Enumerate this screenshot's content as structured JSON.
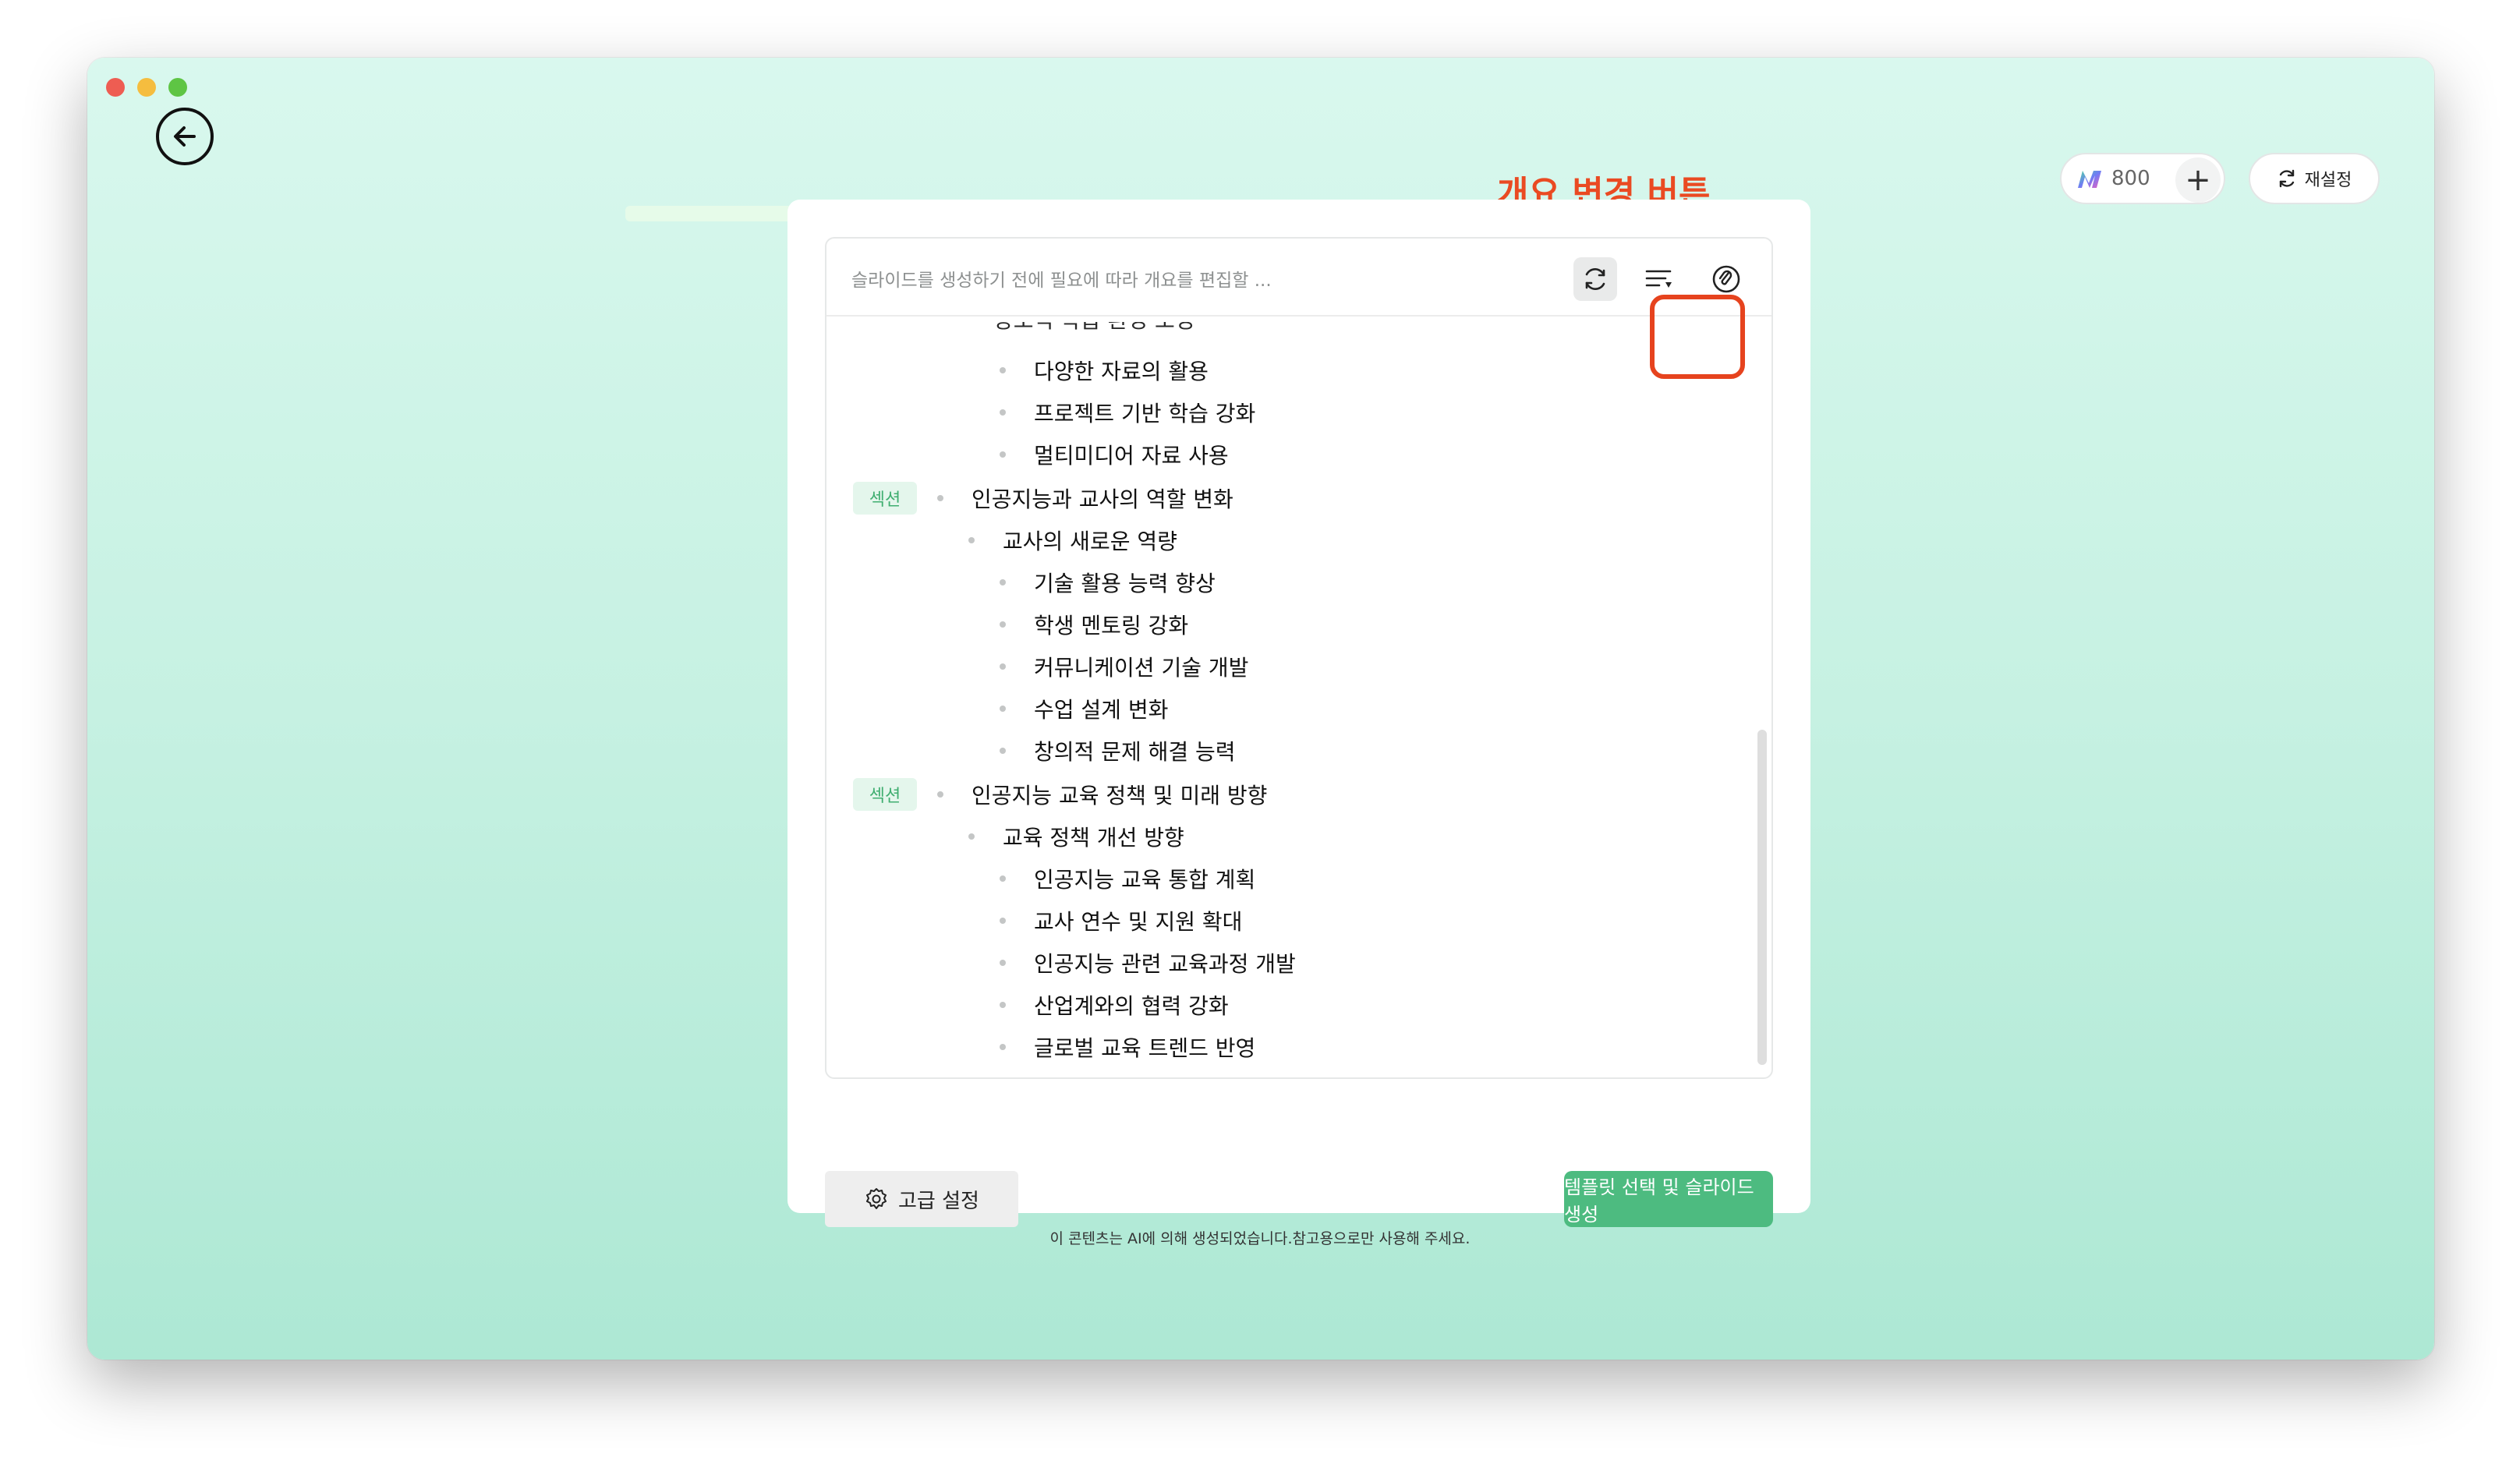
{
  "annotation": "개요 변경 버튼",
  "header": {
    "credits": "800",
    "reset_label": "재설정"
  },
  "editor": {
    "placeholder": "슬라이드를 생성하기 전에 필요에 따라 개요를 편집할 ...",
    "section_badge": "섹션",
    "rows": [
      {
        "level": 3,
        "text": "다양한 자료의 활용"
      },
      {
        "level": 3,
        "text": "프로젝트 기반 학습 강화"
      },
      {
        "level": 3,
        "text": "멀티미디어 자료 사용"
      },
      {
        "level": 1,
        "text": "인공지능과 교사의 역할 변화",
        "section": true
      },
      {
        "level": 2,
        "text": "교사의 새로운 역량"
      },
      {
        "level": 3,
        "text": "기술 활용 능력 향상"
      },
      {
        "level": 3,
        "text": "학생 멘토링 강화"
      },
      {
        "level": 3,
        "text": "커뮤니케이션 기술 개발"
      },
      {
        "level": 3,
        "text": "수업 설계 변화"
      },
      {
        "level": 3,
        "text": "창의적 문제 해결 능력"
      },
      {
        "level": 1,
        "text": "인공지능 교육 정책 및 미래 방향",
        "section": true
      },
      {
        "level": 2,
        "text": "교육 정책 개선 방향"
      },
      {
        "level": 3,
        "text": "인공지능 교육 통합 계획"
      },
      {
        "level": 3,
        "text": "교사 연수 및 지원 확대"
      },
      {
        "level": 3,
        "text": "인공지능 관련 교육과정 개발"
      },
      {
        "level": 3,
        "text": "산업계와의 협력 강화"
      },
      {
        "level": 3,
        "text": "글로벌 교육 트렌드 반영"
      }
    ]
  },
  "footer": {
    "advanced_label": "고급 설정",
    "generate_label": "템플릿 선택 및 슬라이드 생성",
    "disclaimer": "이 콘텐츠는 AI에 의해 생성되었습니다.참고용으로만 사용해 주세요."
  },
  "colors": {
    "accent": "#4dbb80",
    "annotation": "#ea4a22",
    "badge_bg": "#e4f6ec",
    "badge_text": "#3fae70"
  }
}
